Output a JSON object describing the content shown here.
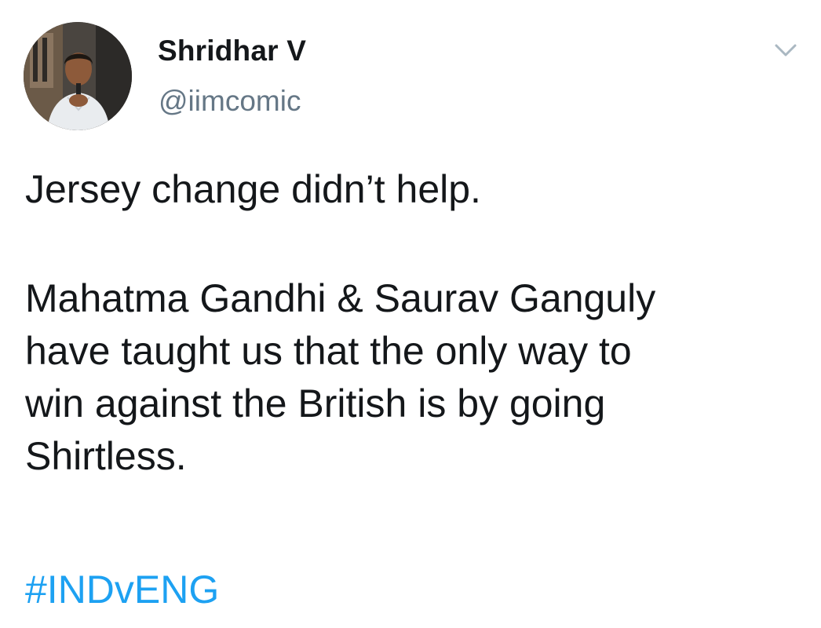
{
  "tweet": {
    "author": {
      "display_name": "Shridhar V",
      "handle": "@iimcomic"
    },
    "text_lines_1": [
      "Jersey change didn’t help."
    ],
    "text_lines_2": [
      "Mahatma Gandhi & Saurav Ganguly",
      "have taught us that the only way to",
      "win against the British is by going",
      "Shirtless."
    ],
    "hashtag": "#INDvENG"
  },
  "icons": {
    "menu": "chevron-down-icon"
  },
  "colors": {
    "text": "#14171a",
    "handle": "#657786",
    "hashtag": "#1da1f2",
    "caret": "#aab8c2"
  }
}
